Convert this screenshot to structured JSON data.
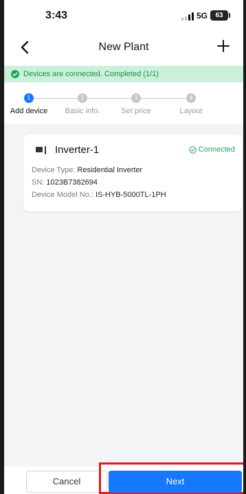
{
  "status_bar": {
    "time": "3:43",
    "network": "5G",
    "battery": "63"
  },
  "nav": {
    "title": "New Plant"
  },
  "banner": {
    "text": "Devices are connected. Completed (1/1)"
  },
  "steps": [
    {
      "number": "1",
      "label": "Add device",
      "active": true
    },
    {
      "number": "2",
      "label": "Basic info.",
      "active": false
    },
    {
      "number": "3",
      "label": "Set price",
      "active": false
    },
    {
      "number": "4",
      "label": "Layout",
      "active": false
    }
  ],
  "device": {
    "name": "Inverter-1",
    "status": "Connected",
    "type_label": "Device Type:",
    "type_value": "Residential Inverter",
    "sn_label": "SN:",
    "sn_value": "1023B7382694",
    "model_label": "Device Model No.:",
    "model_value": "IS-HYB-5000TL-1PH"
  },
  "footer": {
    "cancel_label": "Cancel",
    "next_label": "Next"
  },
  "colors": {
    "accent": "#1677ff",
    "success": "#22a35a",
    "highlight": "#e01b1b"
  }
}
